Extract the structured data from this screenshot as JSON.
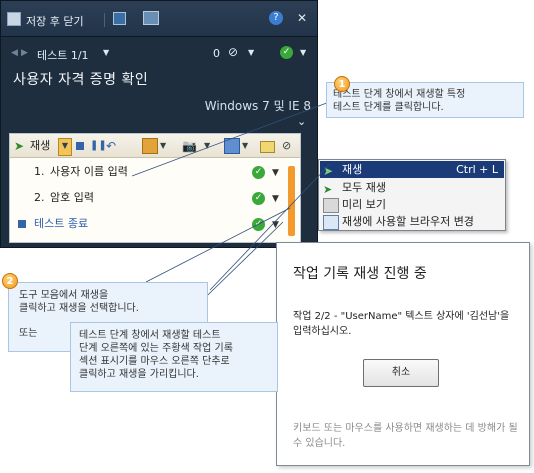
{
  "toolbar": {
    "save_close_label": "저장 후 닫기",
    "test_label": "테스트 1/1",
    "attachment_count": "0"
  },
  "header": {
    "title": "사용자 자격 증명 확인",
    "system_label": "Windows 7 및 IE 8"
  },
  "steps_toolbar": {
    "play_label": "재생"
  },
  "steps": [
    {
      "number": "1.",
      "label": "사용자 이름 입력"
    },
    {
      "number": "2.",
      "label": "암호 입력"
    },
    {
      "number": "",
      "label": "테스트 종료"
    }
  ],
  "context_menu": [
    {
      "label": "재생",
      "shortcut": "Ctrl + L",
      "icon": "play-icon"
    },
    {
      "label": "모두 재생",
      "shortcut": "",
      "icon": "play-all-icon"
    },
    {
      "label": "미리 보기",
      "shortcut": "",
      "icon": "preview-icon"
    },
    {
      "label": "재생에 사용할 브라우저 변경",
      "shortcut": "",
      "icon": "browser-icon"
    }
  ],
  "dialog": {
    "title": "작업 기록 재생 진행 중",
    "message": "작업 2/2 - \"UserName\" 텍스트 상자에 '김선남'을 입력하십시오.",
    "cancel_label": "취소",
    "hint": "키보드 또는 마우스를 사용하면 재생하는 데 방해가 될 수 있습니다."
  },
  "callouts": [
    {
      "number": "1",
      "text_line1": "테스트 단계 창에서 재생할 특정",
      "text_line2": "테스트 단계를 클릭합니다."
    },
    {
      "number": "2",
      "text_line1": "도구 모음에서 재생을",
      "text_line2": "클릭하고 재생을 선택합니다.",
      "or": "또는"
    },
    {
      "number": "",
      "text_line1": "테스트 단계 창에서 재생할 테스트",
      "text_line2": "단계 오른쪽에 있는 주황색 작업 기록",
      "text_line3": "섹션 표시기를 마우스 오른쪽 단추로",
      "text_line4": "클릭하고 재생을 가리킵니다."
    }
  ],
  "colors": {
    "panel_bg": "#1f2e3e",
    "accent_orange": "#f39a2f",
    "menu_selected": "#1a3a78",
    "callout_bg": "#eaf3fc",
    "pass_green": "#3aa93a"
  }
}
